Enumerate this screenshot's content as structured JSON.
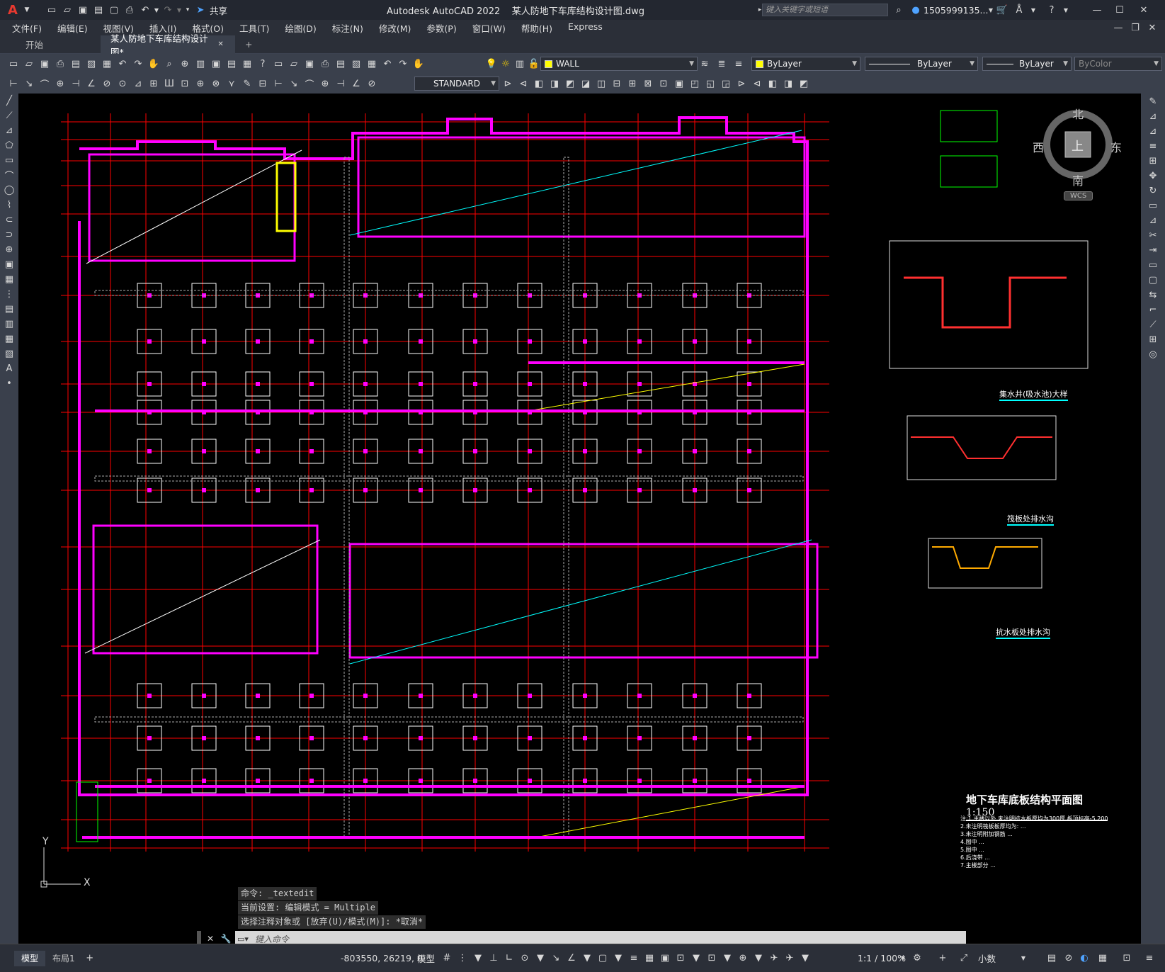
{
  "app": {
    "quick_access_share": "共享",
    "title": "Autodesk AutoCAD 2022    某人防地下车库结构设计图.dwg",
    "search_placeholder": "键入关键字或短语",
    "user": "1505999135...",
    "window_controls": [
      "minimize-icon",
      "maximize-icon",
      "close-icon"
    ]
  },
  "menu": [
    "文件(F)",
    "编辑(E)",
    "视图(V)",
    "插入(I)",
    "格式(O)",
    "工具(T)",
    "绘图(D)",
    "标注(N)",
    "修改(M)",
    "参数(P)",
    "窗口(W)",
    "帮助(H)",
    "Express"
  ],
  "tabs": {
    "start": "开始",
    "active": "某人防地下车库结构设计图*",
    "add": "+"
  },
  "toolbar": {
    "layer": "WALL",
    "layer_color": "#ffff00",
    "color_combo": "ByLayer",
    "linetype_combo": "ByLayer",
    "lineweight_combo": "ByLayer",
    "plotstyle_combo": "ByColor",
    "textstyle_combo": "STANDARD"
  },
  "viewcube": {
    "north": "北",
    "south": "南",
    "east": "东",
    "west": "西",
    "top": "上",
    "wcs": "WCS"
  },
  "drawing": {
    "main_title": "地下车库底板结构平面图",
    "scale": "1:150",
    "detail_1": "集水井(吸水池)大样",
    "detail_2": "筏板处排水沟",
    "detail_3": "抗水板处排水沟",
    "notes": [
      "注:1.主楼以外,未注明抗水板厚均为300厚,板顶标高-5.200",
      "2.未注明筏板板厚均为: ...",
      "3.未注明附加钢筋 ...",
      "4.图中 ...",
      "5.图中 ...",
      "6.后浇带 ...",
      "7.主楼部分 ..."
    ],
    "colors": {
      "wall": "#ff00ff",
      "grid": "#ff0000",
      "cyan": "#00ffff",
      "yellow": "#ffff00",
      "white": "#ffffff",
      "green": "#00ff00"
    },
    "ucs": {
      "x": "X",
      "y": "Y"
    }
  },
  "command": {
    "history": [
      "命令: _textedit",
      "当前设置: 编辑模式 = Multiple",
      "选择注释对象或 [放弃(U)/模式(M)]: *取消*"
    ],
    "placeholder": "键入命令"
  },
  "status": {
    "model_tab": "模型",
    "layout_tab": "布局1",
    "coords": "-803550, 26219, 0",
    "model_space": "模型",
    "scale": "1:1 / 100%",
    "units": "小数"
  }
}
